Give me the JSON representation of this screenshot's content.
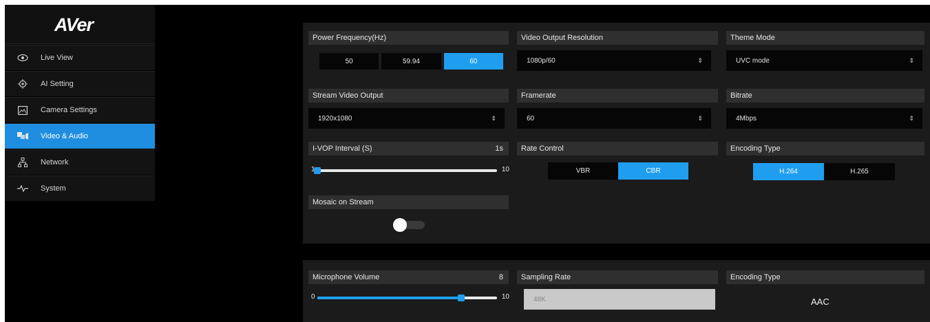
{
  "brand": {
    "logo": "AVer"
  },
  "sidebar": {
    "items": [
      {
        "label": "Live View",
        "icon": "eye-icon",
        "active": false
      },
      {
        "label": "AI Setting",
        "icon": "target-icon",
        "active": false
      },
      {
        "label": "Camera Settings",
        "icon": "image-icon",
        "active": false
      },
      {
        "label": "Video & Audio",
        "icon": "video-audio-icon",
        "active": true
      },
      {
        "label": "Network",
        "icon": "network-icon",
        "active": false
      },
      {
        "label": "System",
        "icon": "pulse-icon",
        "active": false
      }
    ]
  },
  "video": {
    "power_frequency": {
      "label": "Power Frequency(Hz)",
      "options": [
        "50",
        "59.94",
        "60"
      ],
      "selected": "60"
    },
    "video_output_resolution": {
      "label": "Video Output Resolution",
      "value": "1080p/60"
    },
    "theme_mode": {
      "label": "Theme Mode",
      "value": "UVC mode"
    },
    "stream_video_output": {
      "label": "Stream Video Output",
      "value": "1920x1080"
    },
    "framerate": {
      "label": "Framerate",
      "value": "60"
    },
    "bitrate": {
      "label": "Bitrate",
      "value": "4Mbps"
    },
    "ivop_interval": {
      "label": "I-VOP Interval (S)",
      "value_text": "1s",
      "min": "1",
      "max": "10",
      "value": 1
    },
    "rate_control": {
      "label": "Rate Control",
      "options": [
        "VBR",
        "CBR"
      ],
      "selected": "CBR"
    },
    "encoding_type": {
      "label": "Encoding Type",
      "options": [
        "H.264",
        "H.265"
      ],
      "selected": "H.264"
    },
    "mosaic_on_stream": {
      "label": "Mosaic on Stream",
      "enabled": false
    }
  },
  "audio": {
    "microphone_volume": {
      "label": "Microphone Volume",
      "value_text": "8",
      "min": "0",
      "max": "10",
      "value": 8
    },
    "sampling_rate": {
      "label": "Sampling Rate",
      "value": "48K"
    },
    "encoding_type": {
      "label": "Encoding Type",
      "value": "AAC"
    }
  },
  "colors": {
    "accent": "#1f9ef0",
    "active_nav": "#1f8ee0",
    "panel": "#1b1b1b",
    "card_header": "#2f2f2f",
    "field": "#060606"
  }
}
